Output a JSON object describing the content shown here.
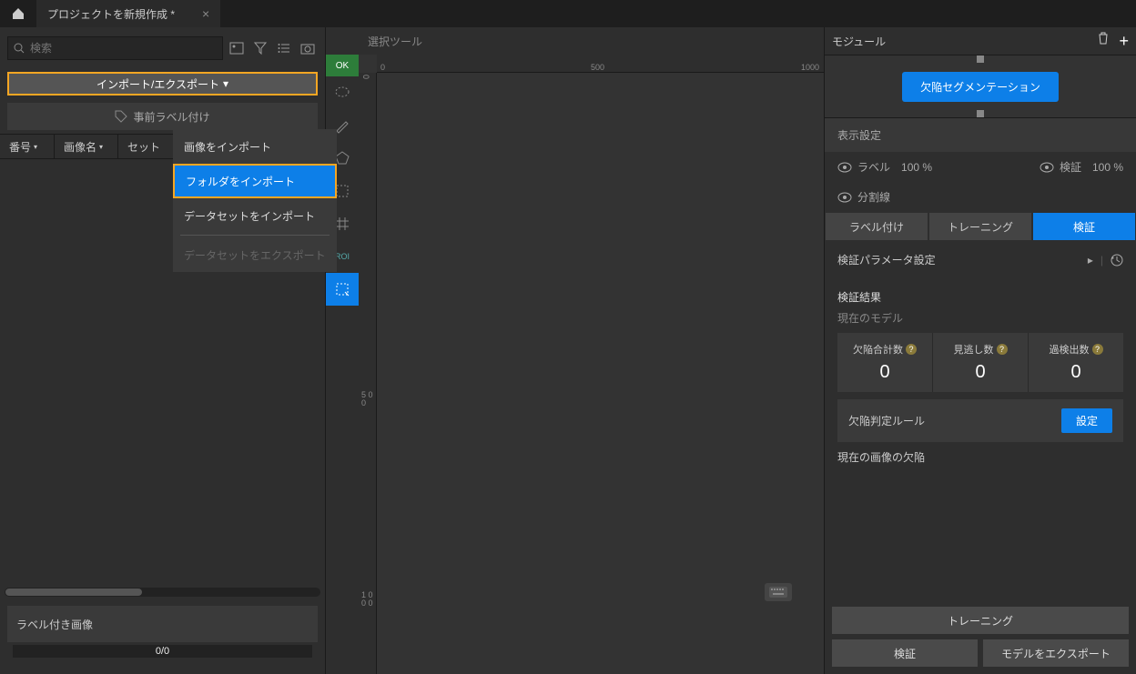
{
  "titlebar": {
    "tab_title": "プロジェクトを新規作成 *"
  },
  "left": {
    "search_placeholder": "検索",
    "import_export_label": "インポート/エクスポート",
    "pre_label": "事前ラベル付け",
    "columns": {
      "no": "番号",
      "name": "画像名",
      "set": "セット"
    },
    "dropdown": {
      "import_images": "画像をインポート",
      "import_folder": "フォルダをインポート",
      "import_dataset": "データセットをインポート",
      "export_dataset": "データセットをエクスポート"
    },
    "labeled_images": "ラベル付き画像",
    "progress": "0/0"
  },
  "center": {
    "tool_name": "選択ツール",
    "ok": "OK",
    "roi": "ROI",
    "ruler": {
      "r0": "0",
      "r500": "500",
      "r1000": "1000",
      "v500": "5\n0\n0",
      "v1000": "1\n0\n0\n0"
    }
  },
  "right": {
    "module_title": "モジュール",
    "node_label": "欠陥セグメンテーション",
    "display_settings": "表示設定",
    "label": "ラベル",
    "label_pct": "100 %",
    "verify": "検証",
    "verify_pct": "100 %",
    "split_line": "分割線",
    "tabs": {
      "labeling": "ラベル付け",
      "training": "トレーニング",
      "validation": "検証"
    },
    "param_settings": "検証パラメータ設定",
    "results_title": "検証結果",
    "current_model": "現在のモデル",
    "metrics": {
      "total": "欠陥合計数",
      "miss": "見逃し数",
      "over": "過検出数",
      "total_val": "0",
      "miss_val": "0",
      "over_val": "0"
    },
    "rule": "欠陥判定ルール",
    "settings_btn": "設定",
    "current_image_defects": "現在の画像の欠陥",
    "buttons": {
      "training": "トレーニング",
      "validate": "検証",
      "export_model": "モデルをエクスポート"
    }
  }
}
